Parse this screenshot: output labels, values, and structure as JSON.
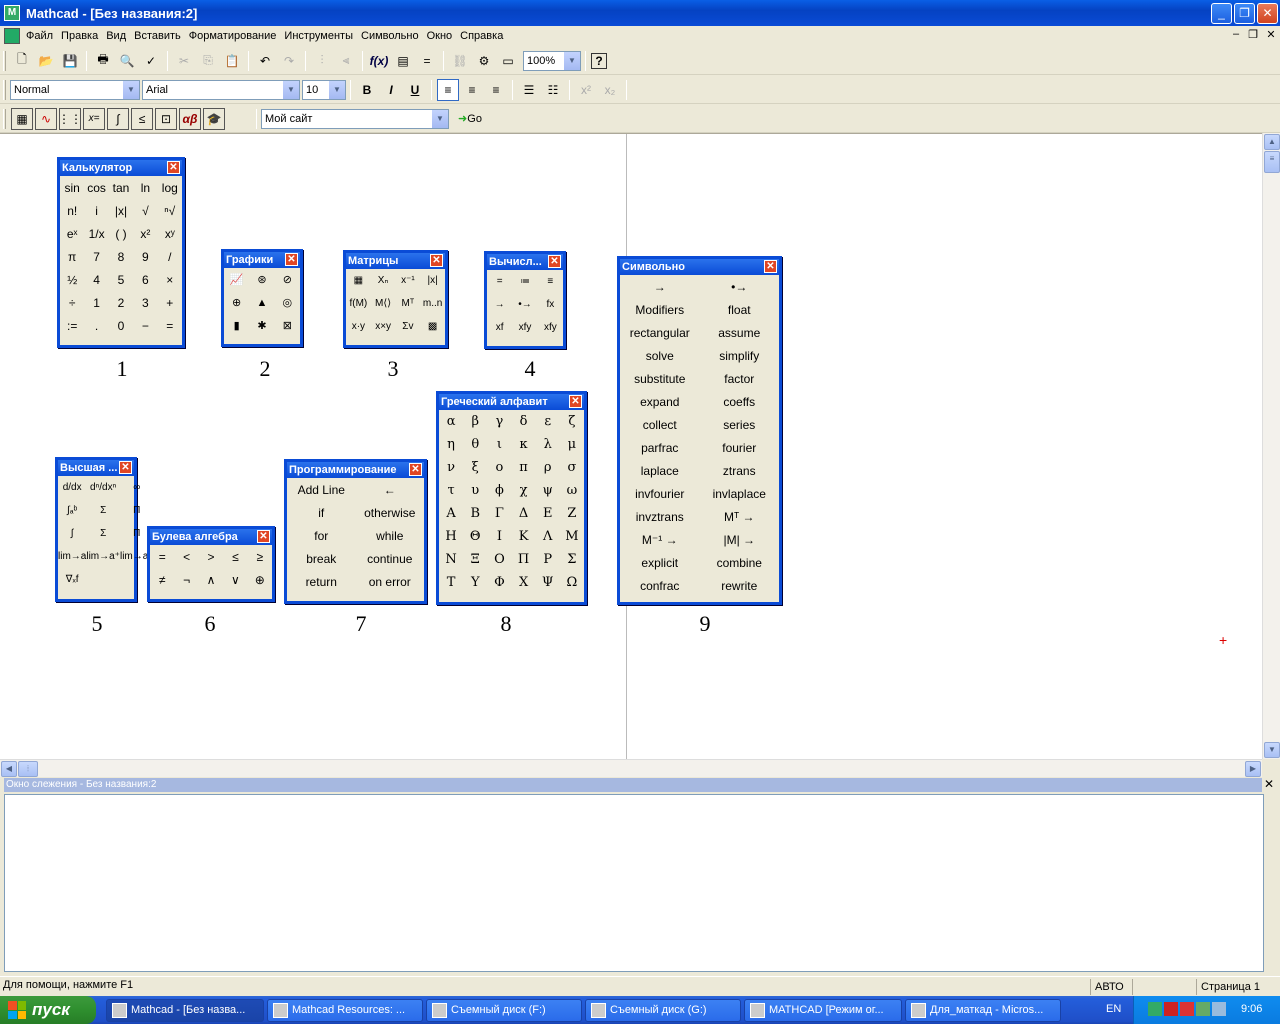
{
  "window": {
    "title": "Mathcad - [Без названия:2]",
    "minimize": "_",
    "restore": "❐",
    "close": "✕"
  },
  "menu": [
    "Файл",
    "Правка",
    "Вид",
    "Вставить",
    "Форматирование",
    "Инструменты",
    "Символьно",
    "Окно",
    "Справка"
  ],
  "doc_controls": {
    "minimize": "–",
    "restore": "❐",
    "close": "✕"
  },
  "toolbar1": {
    "zoom": "100%",
    "help": "?"
  },
  "toolbar2": {
    "style": "Normal",
    "font": "Arial",
    "size": "10",
    "bold": "B",
    "italic": "I",
    "underline": "U"
  },
  "toolbar3": {
    "site": "Мой сайт",
    "go": "Go"
  },
  "palettes": {
    "calculator": {
      "title": "Калькулятор",
      "label": "1",
      "cells": [
        "sin",
        "cos",
        "tan",
        "ln",
        "log",
        "n!",
        "i",
        "|x|",
        "√",
        "ⁿ√",
        "eˣ",
        "1/x",
        "( )",
        "x²",
        "xʸ",
        "π",
        "7",
        "8",
        "9",
        "/",
        "½",
        "4",
        "5",
        "6",
        "×",
        "÷",
        "1",
        "2",
        "3",
        "+",
        ":=",
        ".",
        "0",
        "−",
        "="
      ]
    },
    "graphs": {
      "title": "Графики",
      "label": "2",
      "cells": [
        "📈",
        "⊛",
        "⊘",
        "⊕",
        "▲",
        "◎",
        "▮",
        "✱",
        "⊠"
      ]
    },
    "matrices": {
      "title": "Матрицы",
      "label": "3",
      "cells": [
        "▦",
        "Xₙ",
        "x⁻¹",
        "|x|",
        "f(M)",
        "M⟨⟩",
        "Mᵀ",
        "m..n",
        "x·y",
        "x×y",
        "Σv",
        "▩"
      ]
    },
    "evaluation": {
      "title": "Вычисл...",
      "label": "4",
      "cells": [
        "=",
        "≔",
        "≡",
        "→",
        "•→",
        "fx",
        "xf",
        "xfy",
        "xfy"
      ]
    },
    "calculus": {
      "title": "Высшая ...",
      "label": "5",
      "cells": [
        "d/dx",
        "dⁿ/dxⁿ",
        "∞",
        "∫ₐᵇ",
        "Σ",
        "Π",
        "∫",
        "Σ",
        "Π",
        "lim→a",
        "lim→a⁺",
        "lim→a⁻",
        "∇ₓf"
      ]
    },
    "boolean": {
      "title": "Булева алгебра",
      "label": "6",
      "cells": [
        "=",
        "<",
        ">",
        "≤",
        "≥",
        "≠",
        "¬",
        "∧",
        "∨",
        "⊕"
      ]
    },
    "programming": {
      "title": "Программирование",
      "label": "7",
      "cells": [
        "Add Line",
        "←",
        "if",
        "otherwise",
        "for",
        "while",
        "break",
        "continue",
        "return",
        "on error"
      ]
    },
    "greek": {
      "title": "Греческий алфавит",
      "label": "8",
      "cells": [
        "α",
        "β",
        "γ",
        "δ",
        "ε",
        "ζ",
        "η",
        "θ",
        "ι",
        "κ",
        "λ",
        "μ",
        "ν",
        "ξ",
        "ο",
        "π",
        "ρ",
        "σ",
        "τ",
        "υ",
        "ϕ",
        "χ",
        "ψ",
        "ω",
        "Α",
        "Β",
        "Γ",
        "Δ",
        "Ε",
        "Ζ",
        "Η",
        "Θ",
        "Ι",
        "Κ",
        "Λ",
        "Μ",
        "Ν",
        "Ξ",
        "Ο",
        "Π",
        "Ρ",
        "Σ",
        "Τ",
        "Υ",
        "Φ",
        "Χ",
        "Ψ",
        "Ω"
      ]
    },
    "symbolic": {
      "title": "Символьно",
      "label": "9",
      "cells": [
        "→",
        "•→",
        "Modifiers",
        "float",
        "rectangular",
        "assume",
        "solve",
        "simplify",
        "substitute",
        "factor",
        "expand",
        "coeffs",
        "collect",
        "series",
        "parfrac",
        "fourier",
        "laplace",
        "ztrans",
        "invfourier",
        "invlaplace",
        "invztrans",
        "Mᵀ →",
        "M⁻¹ →",
        "|M| →",
        "explicit",
        "combine",
        "confrac",
        "rewrite"
      ]
    }
  },
  "trace_window": {
    "title": "Окно слежения - Без названия:2",
    "close": "✕"
  },
  "status": {
    "help": "Для помощи, нажмите F1",
    "mode": "АВТО",
    "page": "Страница 1"
  },
  "taskbar": {
    "start": "пуск",
    "tasks": [
      "Mathcad - [Без назва...",
      "Mathcad Resources: ...",
      "Съемный диск (F:)",
      "Съемный диск (G:)",
      "MATHCAD [Режим ог...",
      "Для_маткад - Micros..."
    ],
    "lang": "EN",
    "clock": "9:06"
  }
}
